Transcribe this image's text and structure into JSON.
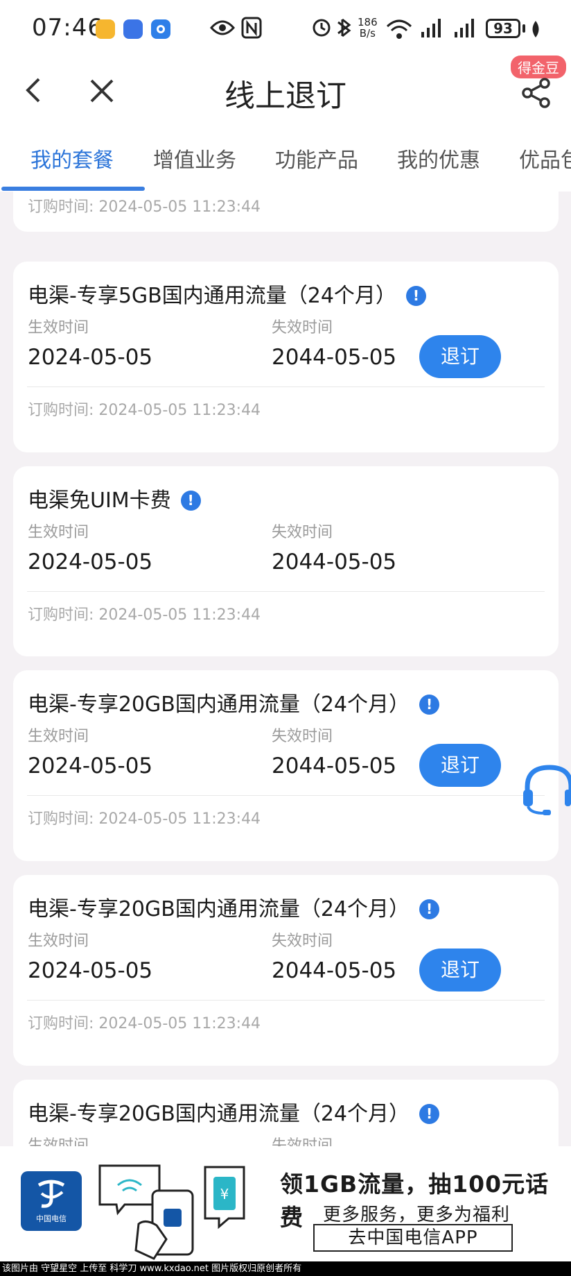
{
  "status_bar": {
    "time": "07:46",
    "speed_value": "186",
    "speed_unit": "B/s",
    "signal_label": "6",
    "battery": "93",
    "icons": [
      "weibo-icon",
      "app-blue-icon",
      "app-ring-icon",
      "eye-icon",
      "nfc-icon",
      "alarm-icon",
      "bluetooth-icon",
      "wifi-icon",
      "signal-icon",
      "battery-icon",
      "leaf-icon"
    ]
  },
  "nav": {
    "title": "线上退订",
    "badge": "得金豆",
    "icons": [
      "back-icon",
      "close-icon",
      "share-icon"
    ]
  },
  "tabs": [
    {
      "label": "我的套餐",
      "active": true
    },
    {
      "label": "增值业务"
    },
    {
      "label": "功能产品"
    },
    {
      "label": "我的优惠"
    },
    {
      "label": "优品包"
    }
  ],
  "labels": {
    "effective": "生效时间",
    "expire": "失效时间",
    "unsubscribe": "退订"
  },
  "cards": [
    {
      "order_time": "订购时间: 2024-05-05 11:23:44"
    },
    {
      "title": "电渠-专享5GB国内通用流量（24个月）",
      "effective": "2024-05-05",
      "expire": "2044-05-05",
      "has_unsubscribe": true,
      "order_time": "订购时间: 2024-05-05 11:23:44"
    },
    {
      "title": "电渠免UIM卡费",
      "effective": "2024-05-05",
      "expire": "2044-05-05",
      "has_unsubscribe": false,
      "order_time": "订购时间: 2024-05-05 11:23:44"
    },
    {
      "title": "电渠-专享20GB国内通用流量（24个月）",
      "effective": "2024-05-05",
      "expire": "2044-05-05",
      "has_unsubscribe": true,
      "order_time": "订购时间: 2024-05-05 11:23:44"
    },
    {
      "title": "电渠-专享20GB国内通用流量（24个月）",
      "effective": "2024-05-05",
      "expire": "2044-05-05",
      "has_unsubscribe": true,
      "order_time": "订购时间: 2024-05-05 11:23:44"
    },
    {
      "title": "电渠-专享20GB国内通用流量（24个月）"
    }
  ],
  "banner": {
    "logo_text": "中国电信",
    "headline": "领1GB流量，抽100元话费",
    "subline": "更多服务，更多为福利",
    "button": "去中国电信APP"
  },
  "footer": "该图片由 守望星空 上传至 科学刀 www.kxdao.net 图片版权归原创者所有",
  "colors": {
    "accent": "#2e84ec",
    "badge": "#f2636b",
    "logo": "#1456a6"
  }
}
